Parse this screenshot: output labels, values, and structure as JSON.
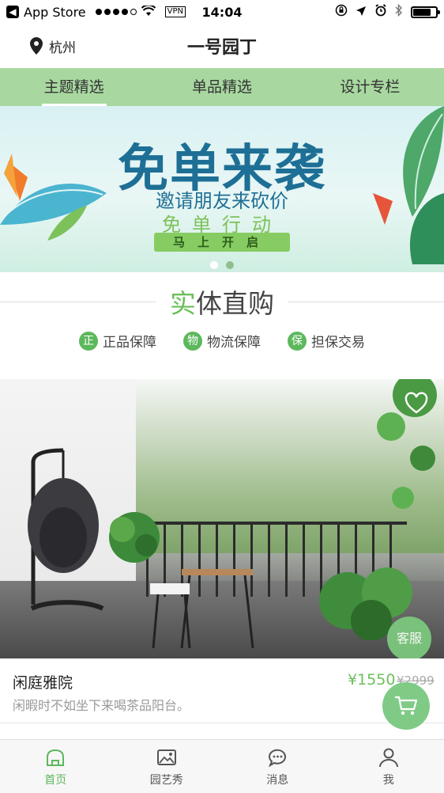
{
  "status_bar": {
    "carrier": "App Store",
    "vpn": "VPN",
    "time": "14:04",
    "battery_level": 0.8
  },
  "header": {
    "location": "杭州",
    "title": "一号园丁"
  },
  "tabs": [
    {
      "label": "主题精选",
      "active": true
    },
    {
      "label": "单品精选",
      "active": false
    },
    {
      "label": "设计专栏",
      "active": false
    }
  ],
  "banner": {
    "headline": "免单来袭",
    "subline": "邀请朋友来砍价",
    "subline2": "免单行动",
    "button_label": "马上开启",
    "slide_count": 2,
    "active_slide": 1
  },
  "section": {
    "title_accent": "实",
    "title_rest": "体直购",
    "guarantees": [
      {
        "badge": "正",
        "label": "正品保障"
      },
      {
        "badge": "物",
        "label": "物流保障"
      },
      {
        "badge": "保",
        "label": "担保交易"
      }
    ]
  },
  "product": {
    "name": "闲庭雅院",
    "description": "闲暇时不如坐下来喝茶品阳台。",
    "price": "¥1550",
    "old_price": "¥2999",
    "service_label": "客服"
  },
  "tabbar": [
    {
      "label": "首页",
      "icon": "home-icon",
      "active": true
    },
    {
      "label": "园艺秀",
      "icon": "gallery-icon",
      "active": false
    },
    {
      "label": "消息",
      "icon": "chat-icon",
      "active": false
    },
    {
      "label": "我",
      "icon": "user-icon",
      "active": false
    }
  ],
  "colors": {
    "accent": "#5cb85c",
    "tab_bar_bg": "#a8d8a0"
  }
}
